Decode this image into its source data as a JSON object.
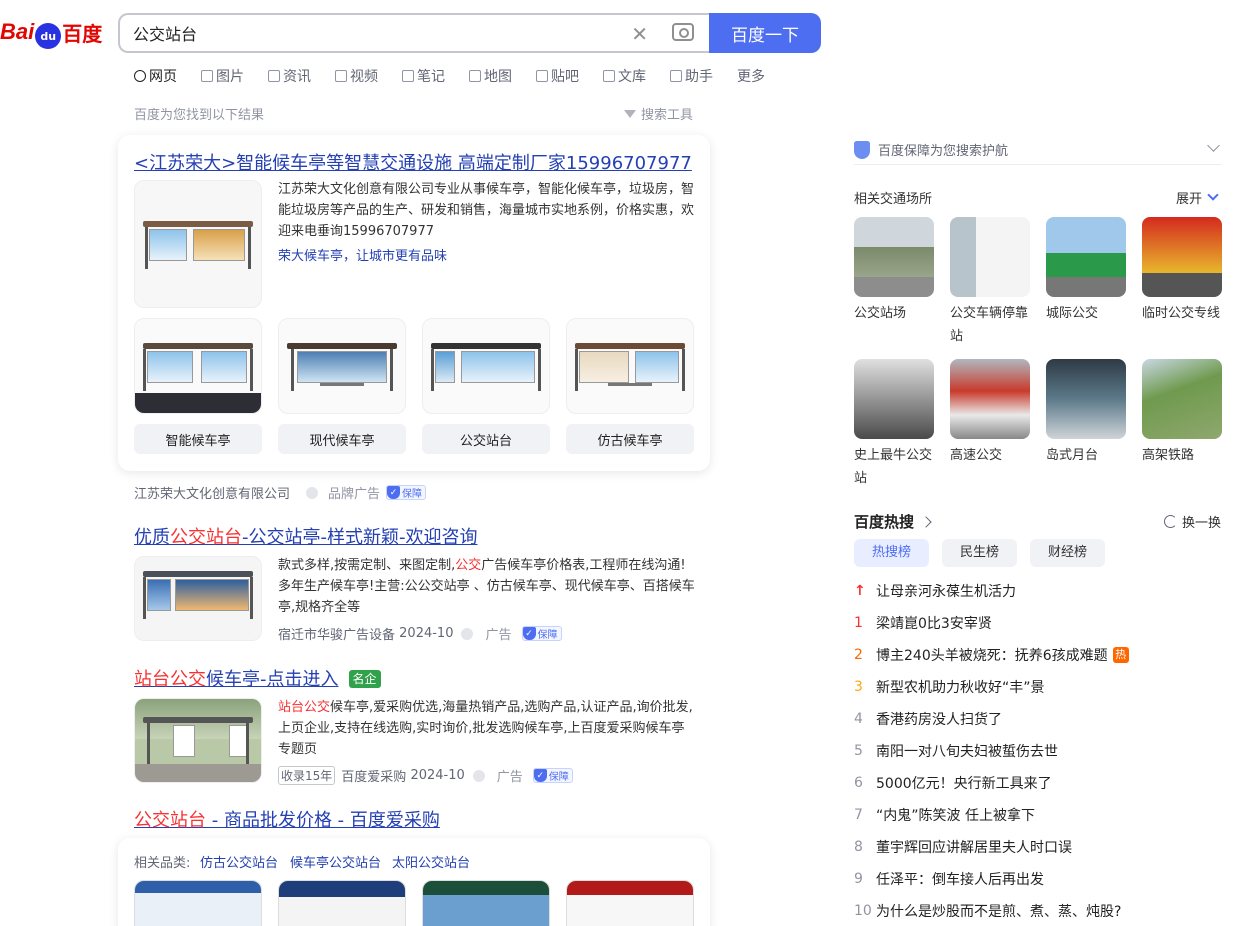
{
  "logo": {
    "text_bai": "Bai",
    "text_du": "du",
    "text_baidu": "百度"
  },
  "search": {
    "query": "公交站台",
    "button_label": "百度一下"
  },
  "tabs": [
    "网页",
    "图片",
    "资讯",
    "视频",
    "笔记",
    "地图",
    "贴吧",
    "文库",
    "助手",
    "更多"
  ],
  "result_count": "百度为您找到以下结果",
  "search_tools": "搜索工具",
  "ad": {
    "title": "<江苏荣大>智能候车亭等智慧交通设施 高端定制厂家15996707977",
    "desc": "江苏荣大文化创意有限公司专业从事候车亭，智能化候车亭，垃圾房，智能垃圾房等产品的生产、研发和销售，海量城市实地系例，价格实惠，欢迎来电垂询15996707977",
    "slogan": "荣大候车亭，让城市更有品味",
    "thumbs": [
      "智能候车亭",
      "现代候车亭",
      "公交站台",
      "仿古候车亭"
    ],
    "source": "江苏荣大文化创意有限公司",
    "tag": "品牌广告",
    "badge": "保障"
  },
  "results": [
    {
      "title_pre": "优质",
      "title_em": "公交站台",
      "title_post": "-公交站亭-样式新颖-欢迎咨询",
      "desc_pre": "款式多样,按需定制、来图定制,",
      "desc_em": "公交",
      "desc_post": "广告候车亭价格表,工程师在线沟通!多年生产候车亭!主营:公公交站亭 、仿古候车亭、现代候车亭、百搭候车亭,规格齐全等",
      "source": "宿迁市华骏广告设备",
      "date": "2024-10",
      "tag": "广告",
      "badge": "保障"
    },
    {
      "title_em": "站台公交",
      "title_post": "候车亭-点击进入",
      "mingqi": "名企",
      "desc_em": "站台公交",
      "desc_post": "候车亭,爱采购优选,海量热销产品,选购产品,认证产品,询价批发,上页企业,支持在线选购,实时询价,批发选购候车亭,上百度爱采购候车亭专题页",
      "years": "收录15年",
      "source": "百度爱采购",
      "date": "2024-10",
      "tag": "广告",
      "badge": "保障"
    },
    {
      "title_em": "公交站台",
      "title_post": " - 商品批发价格 - 百度爱采购",
      "related_label": "相关品类:",
      "related": [
        "仿古公交站台",
        "候车亭公交站台",
        "太阳公交站台"
      ]
    }
  ],
  "right": {
    "protect": "百度保障为您搜索护航",
    "places_title": "相关交通场所",
    "expand": "展开",
    "places": [
      "公交站场",
      "公交车辆停靠站",
      "城际公交",
      "临时公交专线",
      "史上最牛公交站",
      "高速公交",
      "岛式月台",
      "高架铁路"
    ],
    "hot_title": "百度热搜",
    "refresh": "换一换",
    "hot_tabs": [
      "热搜榜",
      "民生榜",
      "财经榜"
    ],
    "hot_items": [
      {
        "rank": "↑",
        "text": "让母亲河永葆生机活力"
      },
      {
        "rank": "1",
        "text": "梁靖崑0比3安宰贤"
      },
      {
        "rank": "2",
        "text": "博主240头羊被烧死：抚养6孩成难题",
        "flag": "热"
      },
      {
        "rank": "3",
        "text": "新型农机助力秋收好“丰”景"
      },
      {
        "rank": "4",
        "text": "香港药房没人扫货了"
      },
      {
        "rank": "5",
        "text": "南阳一对八旬夫妇被蜇伤去世"
      },
      {
        "rank": "6",
        "text": "5000亿元！央行新工具来了"
      },
      {
        "rank": "7",
        "text": "“内鬼”陈笑波 任上被拿下"
      },
      {
        "rank": "8",
        "text": "董宇辉回应讲解居里夫人时口误"
      },
      {
        "rank": "9",
        "text": "任泽平：倒车接人后再出发"
      },
      {
        "rank": "10",
        "text": "为什么是炒股而不是煎、煮、蒸、炖股?"
      }
    ]
  },
  "colors": {
    "brand_blue": "#4e6ef2",
    "link_blue": "#2440b3",
    "highlight_red": "#f73131"
  }
}
